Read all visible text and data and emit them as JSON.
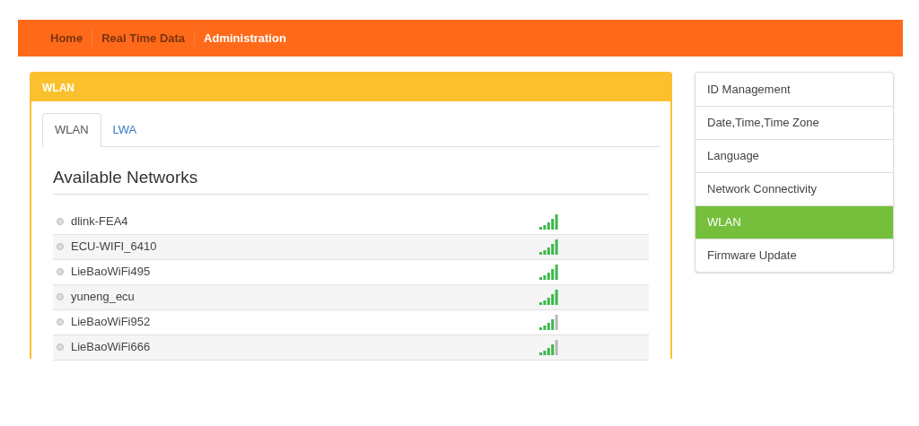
{
  "nav": [
    {
      "label": "Home",
      "selected": false
    },
    {
      "label": "Real Time Data",
      "selected": false
    },
    {
      "label": "Administration",
      "selected": true
    }
  ],
  "panel": {
    "title": "WLAN",
    "tabs": [
      {
        "label": "WLAN",
        "selected": true
      },
      {
        "label": "LWA",
        "selected": false
      }
    ],
    "heading": "Available Networks",
    "networks": [
      {
        "name": "dlink-FEA4",
        "kind": "full"
      },
      {
        "name": "ECU-WIFI_6410",
        "kind": "full"
      },
      {
        "name": "LieBaoWiFi495",
        "kind": "full"
      },
      {
        "name": "yuneng_ecu",
        "kind": "full"
      },
      {
        "name": "LieBaoWiFi952",
        "kind": "good"
      },
      {
        "name": "LieBaoWiFi666",
        "kind": "good"
      }
    ]
  },
  "sidebar": {
    "items": [
      {
        "label": "ID Management",
        "selected": false
      },
      {
        "label": "Date,Time,Time Zone",
        "selected": false
      },
      {
        "label": "Language",
        "selected": false
      },
      {
        "label": "Network Connectivity",
        "selected": false
      },
      {
        "label": "WLAN",
        "selected": true
      },
      {
        "label": "Firmware Update",
        "selected": false
      }
    ]
  }
}
